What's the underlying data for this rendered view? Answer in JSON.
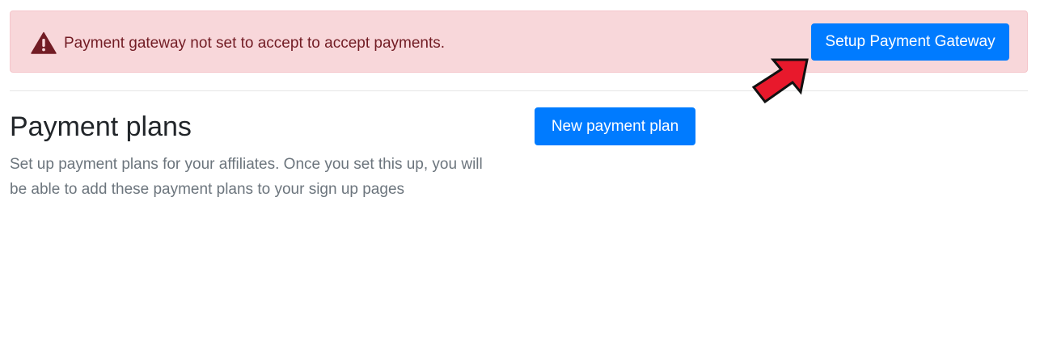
{
  "alert": {
    "message": "Payment gateway not set to accept to accept payments.",
    "icon": "warning-triangle-icon",
    "button_label": "Setup Payment Gateway",
    "background_color": "#f8d7da",
    "text_color": "#721c24"
  },
  "payment_plans": {
    "title": "Payment plans",
    "description": "Set up payment plans for your affiliates. Once you set this up, you will be able to add these payment plans to your sign up pages",
    "new_button_label": "New payment plan"
  },
  "annotation": {
    "icon": "red-arrow-icon",
    "color": "#e8192c"
  },
  "colors": {
    "primary": "#007bff",
    "heading": "#212529",
    "muted": "#6c757d"
  }
}
